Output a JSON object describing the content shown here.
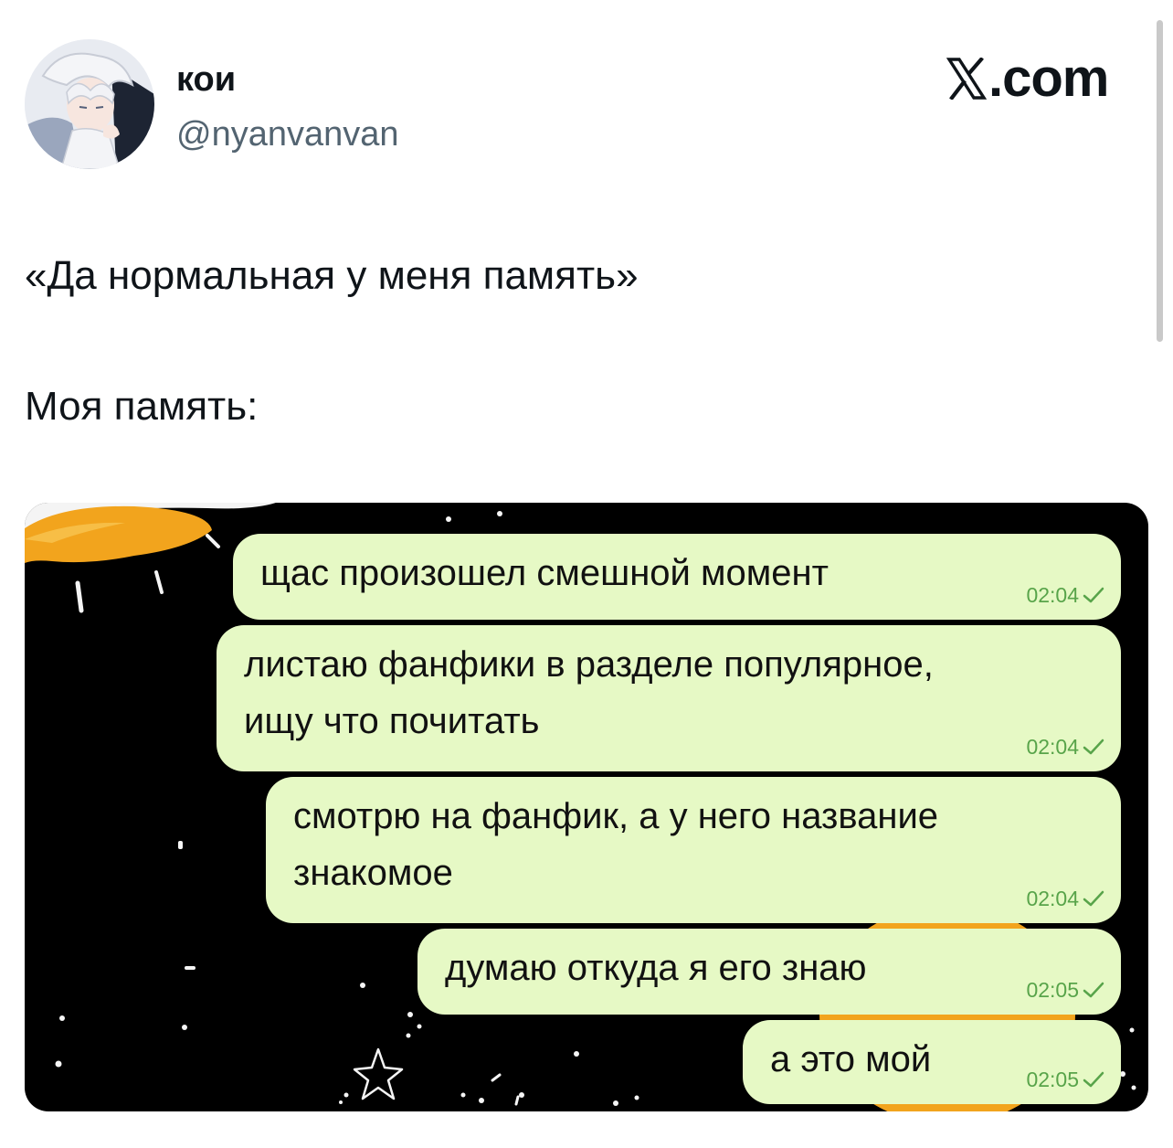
{
  "author": {
    "display_name": "кои",
    "handle": "@nyanvanvan"
  },
  "brand": {
    "domain": ".com",
    "icon": "x-logo-icon"
  },
  "tweet": {
    "line1": "«Да нормальная у меня память»",
    "line2": "Моя память:"
  },
  "chat": {
    "bubble_color": "#e6f9c5",
    "meta_color": "#58a44a",
    "messages": [
      {
        "text": "щас произошел смешной момент",
        "time": "02:04",
        "status": "sent-check-icon"
      },
      {
        "text": "листаю фанфики в разделе популярное,\nищу что почитать",
        "time": "02:04",
        "status": "sent-check-icon"
      },
      {
        "text": "смотрю на фанфик, а у него название\nзнакомое",
        "time": "02:04",
        "status": "sent-check-icon"
      },
      {
        "text": "думаю откуда я его знаю",
        "time": "02:05",
        "status": "sent-check-icon"
      },
      {
        "text": "а это мой",
        "time": "02:05",
        "status": "sent-check-icon"
      }
    ]
  }
}
